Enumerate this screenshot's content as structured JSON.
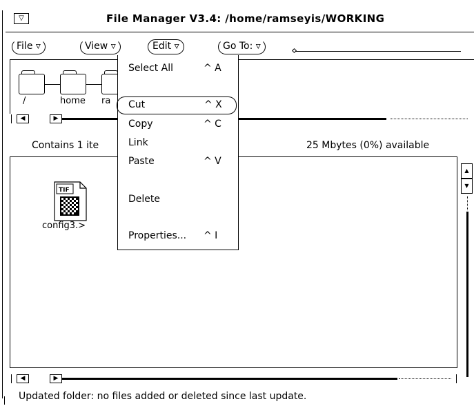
{
  "window": {
    "title": "File Manager V3.4: /home/ramseyis/WORKING",
    "window_menu_glyph": "▽"
  },
  "menubar": {
    "file": "File",
    "view": "View",
    "edit": "Edit",
    "goto": "Go To:",
    "arrow": "▿"
  },
  "path": {
    "segments": [
      "/",
      "home",
      "ra"
    ]
  },
  "scroll": {
    "left_arrow": "◀",
    "right_arrow": "▶",
    "up_arrow": "▲",
    "down_arrow": "▼"
  },
  "info": {
    "contains": "Contains 1 ite",
    "available": "25 Mbytes (0%) available"
  },
  "file": {
    "name": "config3.>",
    "type_label": "TIF",
    "icon": "tif-file-icon"
  },
  "edit_menu": {
    "items": [
      {
        "label": "Select All",
        "accel": "^ A"
      },
      {
        "label": "Cut",
        "accel": "^ X"
      },
      {
        "label": "Copy",
        "accel": "^ C"
      },
      {
        "label": "Link",
        "accel": ""
      },
      {
        "label": "Paste",
        "accel": "^ V"
      },
      {
        "label": "Delete",
        "accel": ""
      },
      {
        "label": "Properties...",
        "accel": "^ I"
      }
    ]
  },
  "status": "Updated folder:  no files added or deleted since last update."
}
